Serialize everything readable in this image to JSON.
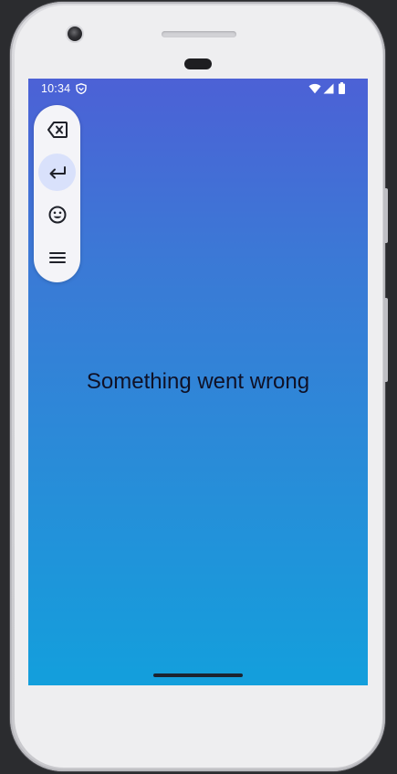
{
  "status_bar": {
    "time": "10:34",
    "vpn_icon": "shield-icon",
    "wifi_icon": "wifi-icon",
    "signal_icon": "cell-signal-icon",
    "battery_icon": "battery-icon"
  },
  "toolbar": {
    "buttons": [
      {
        "icon": "backspace-icon",
        "active": false
      },
      {
        "icon": "enter-arrow-icon",
        "active": true
      },
      {
        "icon": "emoji-icon",
        "active": false
      },
      {
        "icon": "menu-icon",
        "active": false
      }
    ],
    "active_color": "#d9e1fb",
    "background": "#f4f4f8"
  },
  "main": {
    "message": "Something went wrong"
  },
  "colors": {
    "gradient_top": "#4c61d6",
    "gradient_bottom": "#139fdc",
    "text": "#0f1126"
  }
}
